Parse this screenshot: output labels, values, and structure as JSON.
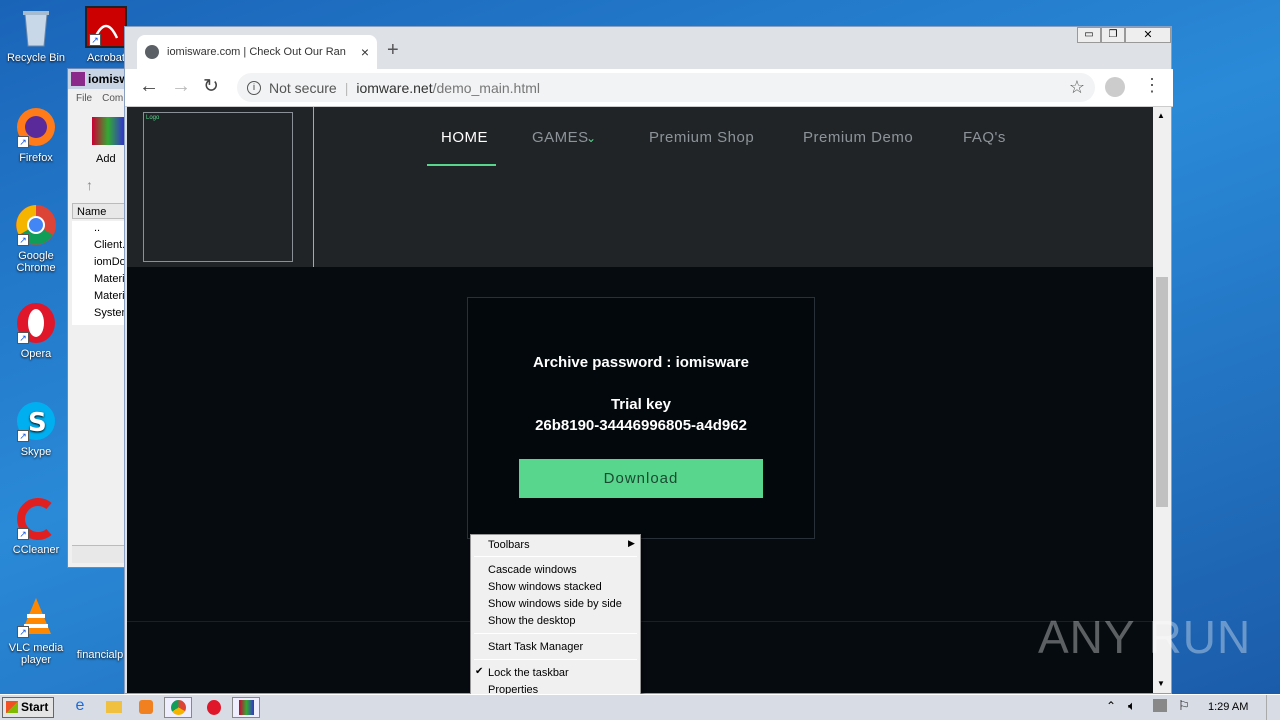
{
  "desktop": {
    "icons": [
      {
        "label": "Recycle Bin"
      },
      {
        "label": "Acrobat"
      },
      {
        "label": "Firefox"
      },
      {
        "label": "Google Chrome"
      },
      {
        "label": "Opera"
      },
      {
        "label": "Skype"
      },
      {
        "label": "CCleaner"
      },
      {
        "label": "VLC media player"
      },
      {
        "label": "financialp"
      }
    ]
  },
  "winrar": {
    "title": "iomisw",
    "menu": [
      "File",
      "Com"
    ],
    "add_label": "Add",
    "column_name": "Name",
    "files": [
      "..",
      "Client.",
      "iomDo",
      "Materi",
      "Materi",
      "Systen"
    ]
  },
  "browser": {
    "tab_title": "iomisware.com | Check Out Our Ran",
    "not_secure": "Not secure",
    "url_domain": "iomware.net",
    "url_path": "/demo_main.html"
  },
  "site": {
    "logo_alt": "Logo",
    "nav": [
      "HOME",
      "GAMES",
      "Premium Shop",
      "Premium Demo",
      "FAQ's"
    ],
    "archive_password": "Archive password : iomisware",
    "trial_key_label": "Trial key",
    "trial_key_value": "26b8190-34446996805-a4d962",
    "download_label": "Download"
  },
  "context_menu": {
    "items": [
      "Toolbars",
      "Cascade windows",
      "Show windows stacked",
      "Show windows side by side",
      "Show the desktop",
      "Start Task Manager",
      "Lock the taskbar",
      "Properties"
    ]
  },
  "taskbar": {
    "start_label": "Start",
    "clock": "1:29 AM"
  },
  "watermark": "ANY RUN",
  "colors": {
    "accent": "#58d68d",
    "nav_active": "#ffffff"
  }
}
